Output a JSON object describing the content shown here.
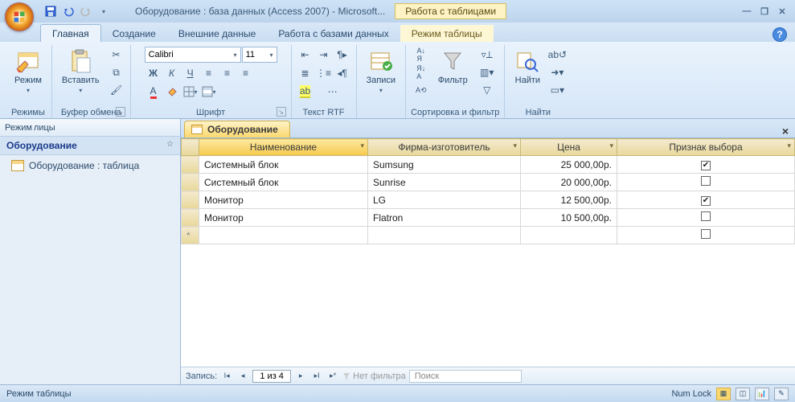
{
  "title": "Оборудование : база данных (Access 2007) - Microsoft...",
  "contextual_group": "Работа с таблицами",
  "tabs": {
    "home": "Главная",
    "create": "Создание",
    "external": "Внешние данные",
    "dbtools": "Работа с базами данных",
    "datasheet": "Режим таблицы"
  },
  "ribbon": {
    "views_group": "Режимы",
    "view_btn": "Режим",
    "clipboard_group": "Буфер обмена",
    "paste_btn": "Вставить",
    "font_group": "Шрифт",
    "font_name": "Calibri",
    "font_size": "11",
    "richtext_group": "Текст RTF",
    "records_group": "Записи",
    "records_btn": "Записи",
    "sortfilter_group": "Сортировка и фильтр",
    "filter_btn": "Фильтр",
    "find_group": "Найти",
    "find_btn": "Найти"
  },
  "nav": {
    "viewbar_label": "Режим",
    "group_label": "лицы",
    "category": "Оборудование",
    "item1": "Оборудование : таблица"
  },
  "doc": {
    "tab_label": "Оборудование",
    "columns": {
      "name": "Наименование",
      "manufacturer": "Фирма-изготовитель",
      "price": "Цена",
      "flag": "Признак выбора"
    },
    "rows": [
      {
        "name": "Системный блок",
        "manufacturer": "Sumsung",
        "price": "25 000,00р.",
        "flag": true
      },
      {
        "name": "Системный блок",
        "manufacturer": "Sunrise",
        "price": "20 000,00р.",
        "flag": false
      },
      {
        "name": "Монитор",
        "manufacturer": "LG",
        "price": "12 500,00р.",
        "flag": true
      },
      {
        "name": "Монитор",
        "manufacturer": "Flatron",
        "price": "10 500,00р.",
        "flag": false
      }
    ]
  },
  "recnav": {
    "label": "Запись:",
    "pos": "1 из 4",
    "nofilter": "Нет фильтра",
    "search": "Поиск"
  },
  "status": {
    "mode": "Режим таблицы",
    "numlock": "Num Lock"
  }
}
